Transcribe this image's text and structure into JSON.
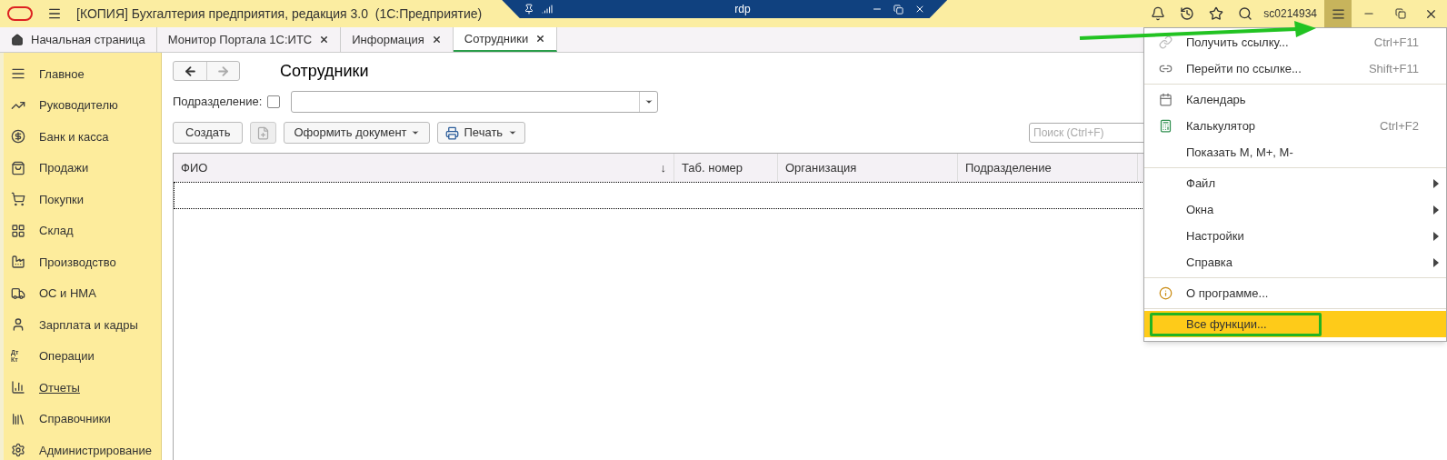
{
  "title_bar": {
    "title": "[КОПИЯ] Бухгалтерия предприятия, редакция 3.0  (1С:Предприятие)",
    "remote_bar": {
      "label": "rdp"
    },
    "user": "sc0214934",
    "menu_button": {
      "selected": true
    }
  },
  "tabs": [
    {
      "label": "Начальная страница",
      "home": true,
      "closable": false,
      "selected": false
    },
    {
      "label": "Монитор Портала 1С:ИТС",
      "home": false,
      "closable": true,
      "selected": false
    },
    {
      "label": "Информация",
      "home": false,
      "closable": true,
      "selected": false
    },
    {
      "label": "Сотрудники",
      "home": false,
      "closable": true,
      "selected": true
    }
  ],
  "sidebar": {
    "items": [
      {
        "label": "Главное",
        "hovered": false
      },
      {
        "label": "Руководителю",
        "hovered": false
      },
      {
        "label": "Банк и касса",
        "hovered": false
      },
      {
        "label": "Продажи",
        "hovered": false
      },
      {
        "label": "Покупки",
        "hovered": false
      },
      {
        "label": "Склад",
        "hovered": false
      },
      {
        "label": "Производство",
        "hovered": false
      },
      {
        "label": "ОС и НМА",
        "hovered": false
      },
      {
        "label": "Зарплата и кадры",
        "hovered": false
      },
      {
        "label": "Операции",
        "hovered": false,
        "icon_label": "Дт Кт"
      },
      {
        "label": "Отчеты",
        "hovered": true
      },
      {
        "label": "Справочники",
        "hovered": false
      },
      {
        "label": "Администрирование",
        "hovered": false
      }
    ]
  },
  "form": {
    "title": "Сотрудники",
    "filter": {
      "label": "Подразделение:",
      "checked": false
    },
    "buttons": [
      {
        "kind": "text",
        "label": "Создать"
      },
      {
        "kind": "icon",
        "disabled": true
      },
      {
        "kind": "dropdown",
        "label": "Оформить документ"
      },
      {
        "kind": "print",
        "label": "Печать"
      }
    ],
    "search": {
      "placeholder": "Поиск (Ctrl+F)"
    },
    "table": {
      "columns": [
        {
          "label": "ФИО",
          "sort": "↓"
        },
        {
          "label": "Таб. номер"
        },
        {
          "label": "Организация"
        },
        {
          "label": "Подразделение"
        }
      ]
    }
  },
  "menu": {
    "groups": [
      {
        "items": [
          {
            "label": "Получить ссылку...",
            "shortcut": "Ctrl+F11",
            "submenu": false,
            "selected": false
          },
          {
            "label": "Перейти по ссылке...",
            "shortcut": "Shift+F11",
            "submenu": false,
            "selected": false
          }
        ]
      },
      {
        "items": [
          {
            "label": "Календарь",
            "submenu": false,
            "selected": false
          },
          {
            "label": "Калькулятор",
            "shortcut": "Ctrl+F2",
            "submenu": false,
            "selected": false
          },
          {
            "label": "Показать M, M+, M-",
            "submenu": false,
            "selected": false
          }
        ]
      },
      {
        "items": [
          {
            "label": "Файл",
            "submenu": true,
            "selected": false
          },
          {
            "label": "Окна",
            "submenu": true,
            "selected": false
          },
          {
            "label": "Настройки",
            "submenu": true,
            "selected": false
          },
          {
            "label": "Справка",
            "submenu": true,
            "selected": false
          }
        ]
      },
      {
        "items": [
          {
            "label": "О программе...",
            "submenu": false,
            "selected": false
          }
        ]
      },
      {
        "items": [
          {
            "label": "Все функции...",
            "submenu": false,
            "selected": true,
            "outlined": true
          }
        ]
      }
    ]
  }
}
